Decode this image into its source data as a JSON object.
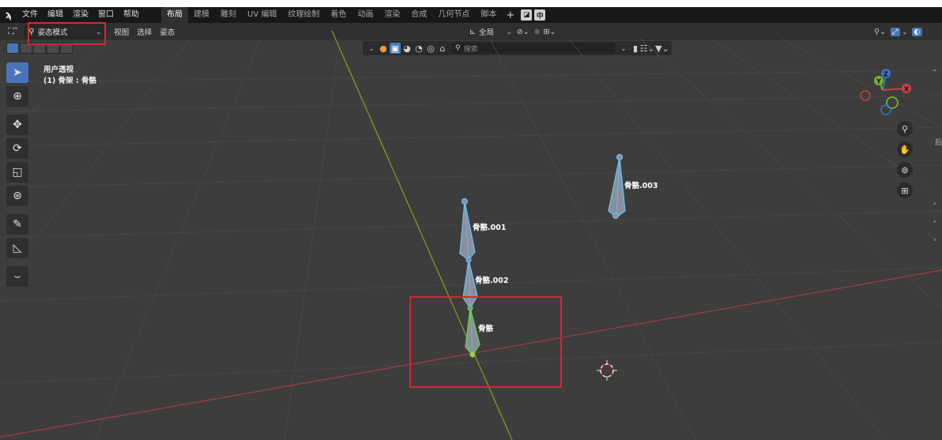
{
  "menubar": {
    "logo": "ϡ",
    "menus": [
      "文件",
      "编辑",
      "渲染",
      "窗口",
      "帮助"
    ],
    "workspaces": [
      "布局",
      "建模",
      "雕刻",
      "UV 编辑",
      "纹理绘制",
      "着色",
      "动画",
      "渲染",
      "合成",
      "几何节点",
      "脚本"
    ],
    "active_workspace": "布局",
    "add_label": "+",
    "lang_label": "中"
  },
  "header": {
    "mode_label": "姿态模式",
    "view_menu": "视图",
    "select_menu": "选择",
    "pose_menu": "姿态",
    "transform_orientation": "全局"
  },
  "toolbar_row": {
    "search_placeholder": "搜索"
  },
  "viewport": {
    "view_name": "用户透视",
    "object_info": "(1) 骨架 : 骨骼",
    "bones": {
      "b0": "骨骼",
      "b1": "骨骼.001",
      "b2": "骨骼.002",
      "b3": "骨骼.003"
    },
    "gizmo": {
      "x": "X",
      "y": "Y",
      "z": "Z"
    }
  },
  "right_edge": {
    "glyph": "后"
  },
  "colors": {
    "highlight_box": "#d6262e",
    "active_tool": "#4a74b8",
    "bone_selected": "#6fc0e8",
    "bone_active": "#6ad04a"
  }
}
